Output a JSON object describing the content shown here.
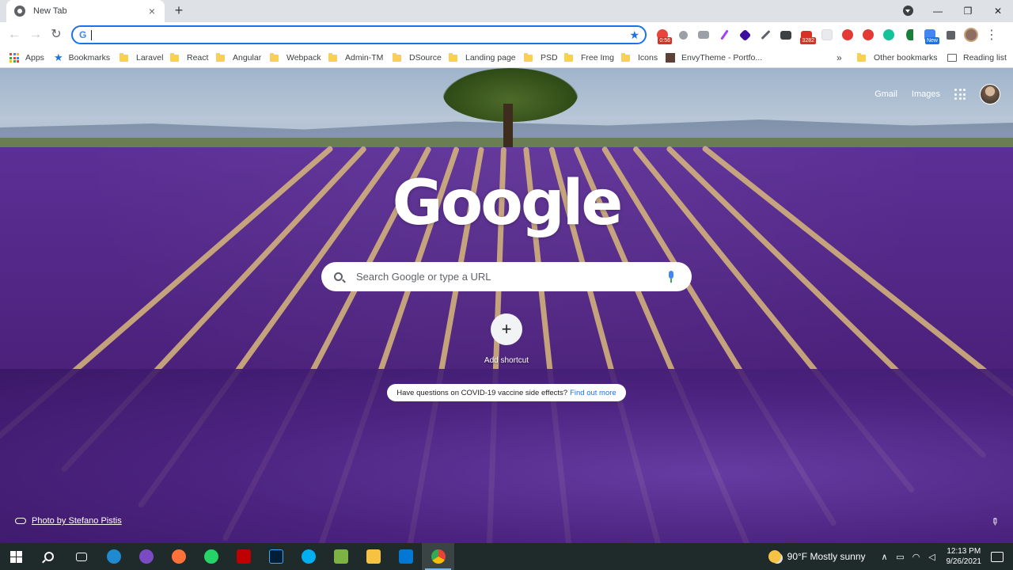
{
  "browser": {
    "tab_title": "New Tab",
    "tab_close": "×",
    "new_tab": "+",
    "window_controls": {
      "minimize": "—",
      "maximize": "❐",
      "close": "✕"
    },
    "nav": {
      "back": "←",
      "forward": "→",
      "reload": "↻"
    },
    "omnibox": {
      "value": "",
      "star": "★"
    },
    "extension_badges": {
      "timer": "0:56",
      "mail_count": "3282",
      "new_label": "New"
    },
    "menu": "⋮"
  },
  "bookmarks": {
    "items": [
      {
        "label": "Apps",
        "icon": "apps-grid-icon"
      },
      {
        "label": "Bookmarks",
        "icon": "star-icon"
      },
      {
        "label": "Laravel",
        "icon": "folder-icon"
      },
      {
        "label": "React",
        "icon": "folder-icon"
      },
      {
        "label": "Angular",
        "icon": "folder-icon"
      },
      {
        "label": "Webpack",
        "icon": "folder-icon"
      },
      {
        "label": "Admin-TM",
        "icon": "folder-icon"
      },
      {
        "label": "DSource",
        "icon": "folder-icon"
      },
      {
        "label": "Landing page",
        "icon": "folder-icon"
      },
      {
        "label": "PSD",
        "icon": "folder-icon"
      },
      {
        "label": "Free Img",
        "icon": "folder-icon"
      },
      {
        "label": "Icons",
        "icon": "folder-icon"
      },
      {
        "label": "EnvyTheme - Portfo...",
        "icon": "site-icon"
      }
    ],
    "overflow": "»",
    "other": "Other bookmarks",
    "reading_list": "Reading list"
  },
  "ntp": {
    "top_links": {
      "gmail": "Gmail",
      "images": "Images"
    },
    "logo": "Google",
    "search_placeholder": "Search Google or type a URL",
    "shortcut": {
      "plus": "+",
      "label": "Add shortcut"
    },
    "promo": {
      "text": "Have questions on COVID-19 vaccine side effects?",
      "link": "Find out more"
    },
    "attribution": "Photo by Stefano Pistis",
    "edit": "✎"
  },
  "taskbar": {
    "weather": "90°F  Mostly sunny",
    "time": "12:13 PM",
    "date": "9/26/2021",
    "tray_up": "∧"
  },
  "colors": {
    "accent": "#1a73e8",
    "lavender": "#5a2d8c",
    "taskbar": "#1f2a2a"
  }
}
